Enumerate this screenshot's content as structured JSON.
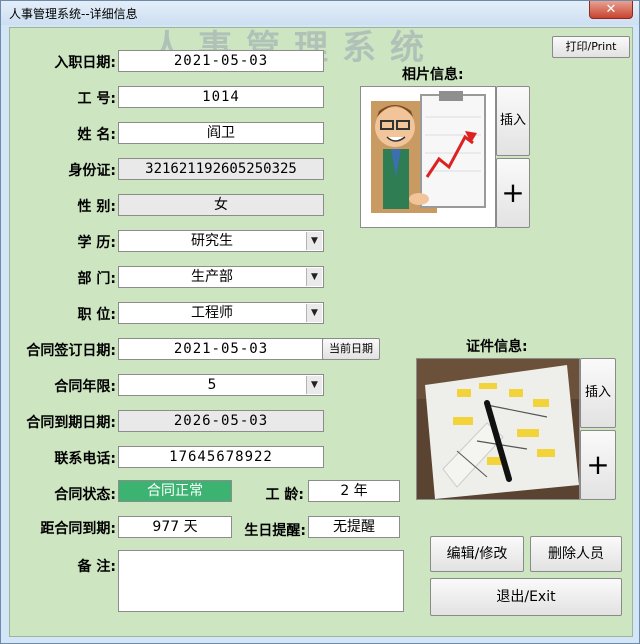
{
  "window": {
    "title": "人事管理系统--详细信息",
    "watermark": "人事管理系统",
    "close": "✕"
  },
  "print_button": "打印/Print",
  "fields": {
    "hire_date": {
      "label": "入职日期:",
      "value": "2021-05-03"
    },
    "emp_no": {
      "label": "工  号:",
      "value": "1014"
    },
    "name": {
      "label": "姓  名:",
      "value": "阎卫"
    },
    "id_card": {
      "label": "身份证:",
      "value": "321621192605250325"
    },
    "gender": {
      "label": "性  别:",
      "value": "女"
    },
    "education": {
      "label": "学  历:",
      "value": "研究生"
    },
    "department": {
      "label": "部  门:",
      "value": "生产部"
    },
    "position": {
      "label": "职  位:",
      "value": "工程师"
    },
    "contract_sign_date": {
      "label": "合同签订日期:",
      "value": "2021-05-03"
    },
    "contract_years": {
      "label": "合同年限:",
      "value": "5"
    },
    "contract_end_date": {
      "label": "合同到期日期:",
      "value": "2026-05-03"
    },
    "phone": {
      "label": "联系电话:",
      "value": "17645678922"
    },
    "contract_status": {
      "label": "合同状态:",
      "value": "合同正常"
    },
    "seniority": {
      "label": "工  龄:",
      "value": "2 年"
    },
    "days_to_expiry": {
      "label": "距合同到期:",
      "value": "977 天"
    },
    "birthday_reminder": {
      "label": "生日提醒:",
      "value": "无提醒"
    },
    "notes": {
      "label": "备  注:",
      "value": ""
    }
  },
  "today_button": "当前日期",
  "photo": {
    "label": "相片信息:",
    "insert": "插入",
    "add": "+"
  },
  "certificate": {
    "label": "证件信息:",
    "insert": "插入",
    "add": "+"
  },
  "actions": {
    "edit": "编辑/修改",
    "delete": "删除人员",
    "exit": "退出/Exit"
  },
  "colors": {
    "client_bg": "#cde5c0",
    "status_green": "#3cb371",
    "close_red": "#c7432f"
  }
}
